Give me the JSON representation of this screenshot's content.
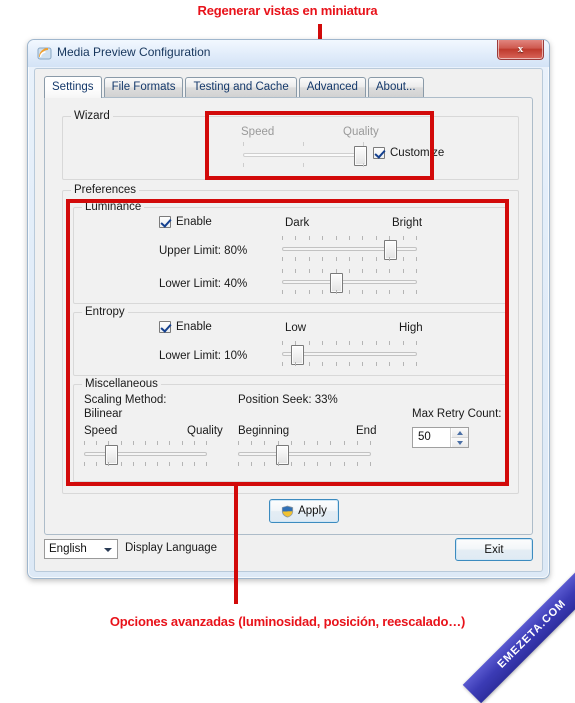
{
  "annotations": {
    "top": "Regenerar vistas en miniatura",
    "bottom": "Opciones avanzadas (luminosidad, posición, reescalado…)",
    "color": "#e8121a"
  },
  "watermark": {
    "text": "EMEZETA.COM"
  },
  "window": {
    "title": "Media Preview Configuration",
    "icon": "media-preview-icon",
    "close_label": "x"
  },
  "tabs": [
    {
      "label": "Settings",
      "active": true
    },
    {
      "label": "File Formats",
      "active": false
    },
    {
      "label": "Testing and Cache",
      "active": false
    },
    {
      "label": "Advanced",
      "active": false
    },
    {
      "label": "About...",
      "active": false
    }
  ],
  "wizard": {
    "legend": "Wizard",
    "slider_left_label": "Speed",
    "slider_right_label": "Quality",
    "slider_value_pct": 97,
    "customize_label": "Customize",
    "customize_checked": true
  },
  "preferences": {
    "legend": "Preferences",
    "luminance": {
      "legend": "Luminance",
      "enable_label": "Enable",
      "enable_checked": true,
      "left_label": "Dark",
      "right_label": "Bright",
      "upper_limit_label": "Upper Limit: 80%",
      "upper_limit_pct": 80,
      "lower_limit_label": "Lower Limit: 40%",
      "lower_limit_pct": 40
    },
    "entropy": {
      "legend": "Entropy",
      "enable_label": "Enable",
      "enable_checked": true,
      "left_label": "Low",
      "right_label": "High",
      "lower_limit_label": "Lower Limit: 10%",
      "lower_limit_pct": 10
    },
    "miscellaneous": {
      "legend": "Miscellaneous",
      "scaling_method_label": "Scaling Method:",
      "scaling_method_value": "Bilinear",
      "scaling_left_label": "Speed",
      "scaling_right_label": "Quality",
      "scaling_pct": 22,
      "position_seek_label": "Position Seek: 33%",
      "position_left_label": "Beginning",
      "position_right_label": "End",
      "position_pct": 33,
      "max_retry_label": "Max Retry Count:",
      "max_retry_value": "50"
    }
  },
  "apply": {
    "label": "Apply",
    "icon": "uac-shield-icon"
  },
  "footer": {
    "language_value": "English",
    "language_label": "Display Language",
    "exit_label": "Exit"
  }
}
